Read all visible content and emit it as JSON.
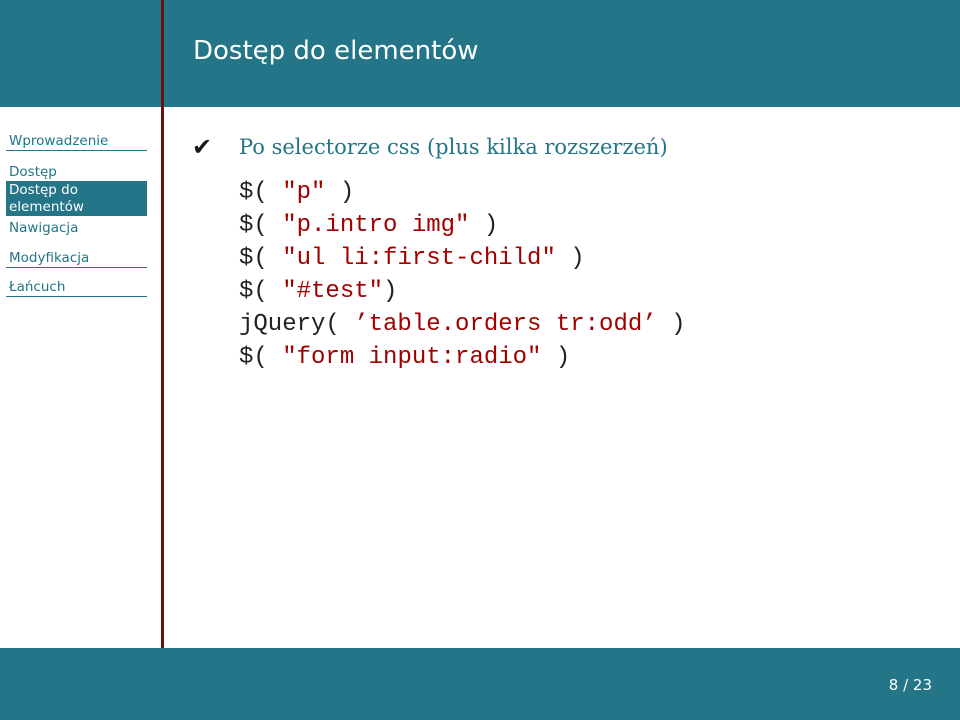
{
  "slide": {
    "title": "Dostęp do elementów",
    "page_current": "8",
    "page_separator": "/",
    "page_total": "23"
  },
  "sidebar": {
    "items": [
      {
        "label": "Wprowadzenie"
      },
      {
        "label": "Dostęp"
      },
      {
        "label": "Dostęp do"
      },
      {
        "label": "elementów"
      },
      {
        "label": "Nawigacja"
      },
      {
        "label": "Modyfikacja"
      },
      {
        "label": "Łańcuch"
      }
    ]
  },
  "content": {
    "bullet_icon": "check-icon",
    "bullet_text": "Po selectorze css (plus kilka rozszerzeń)",
    "code_lines": [
      {
        "prefix": "$( ",
        "string": "\"p\"",
        "suffix": " )"
      },
      {
        "prefix": "$( ",
        "string": "\"p.intro img\"",
        "suffix": " )"
      },
      {
        "prefix": "$( ",
        "string": "\"ul li:first-child\"",
        "suffix": " )"
      },
      {
        "prefix": "$( ",
        "string": "\"#test\"",
        "suffix": ")"
      },
      {
        "prefix": "jQuery( ",
        "string": "’table.orders tr:odd’",
        "suffix": " )"
      },
      {
        "prefix": "$( ",
        "string": "\"form input:radio\"",
        "suffix": " )"
      }
    ]
  },
  "colors": {
    "primary": "#237587",
    "divider": "#6e1010",
    "code_string": "#a00000"
  }
}
